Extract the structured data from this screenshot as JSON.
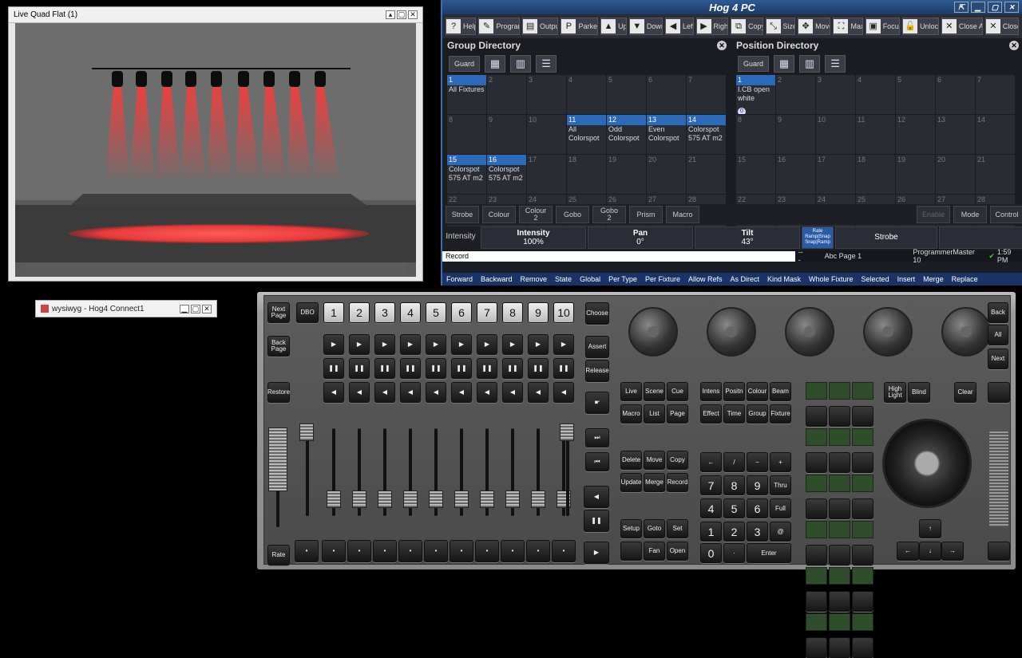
{
  "wysiwyg_window": {
    "title": "Live Quad Flat (1)",
    "minimize": "▴",
    "restore": "▢",
    "close": "✕"
  },
  "taskbar_item": {
    "label": "wysiwyg - Hog4 Connect1"
  },
  "hog": {
    "title": "Hog 4 PC",
    "window_controls": [
      "⇱",
      "▁",
      "▢",
      "✕"
    ],
    "toolbar": [
      {
        "label": "Help",
        "icon": "?"
      },
      {
        "label": "Program",
        "icon": "✎"
      },
      {
        "label": "Output",
        "icon": "▤"
      },
      {
        "label": "Parked",
        "icon": "P"
      },
      {
        "label": "Up",
        "icon": "▲"
      },
      {
        "label": "Down",
        "icon": "▼"
      },
      {
        "label": "Left",
        "icon": "◀"
      },
      {
        "label": "Right",
        "icon": "▶"
      },
      {
        "label": "Copy",
        "icon": "⧉"
      },
      {
        "label": "Size",
        "icon": "⤡"
      },
      {
        "label": "Move",
        "icon": "✥"
      },
      {
        "label": "Max",
        "icon": "⛶"
      },
      {
        "label": "Focus",
        "icon": "▣"
      },
      {
        "label": "Unlock",
        "icon": "🔓"
      },
      {
        "label": "Close All",
        "icon": "✕"
      },
      {
        "label": "Close",
        "icon": "✕"
      }
    ],
    "group_directory": {
      "title": "Group Directory",
      "guard": "Guard",
      "cells": [
        {
          "n": "1",
          "l": "All Fixtures",
          "on": true
        },
        {
          "n": "2"
        },
        {
          "n": "3"
        },
        {
          "n": "4"
        },
        {
          "n": "5"
        },
        {
          "n": "6"
        },
        {
          "n": "7"
        },
        {
          "n": "8"
        },
        {
          "n": "9"
        },
        {
          "n": "10"
        },
        {
          "n": "11",
          "l": "All Colorspot",
          "on": true
        },
        {
          "n": "12",
          "l": "Odd Colorspot",
          "on": true
        },
        {
          "n": "13",
          "l": "Even Colorspot",
          "on": true
        },
        {
          "n": "14",
          "l": "Colorspot 575 AT m2",
          "on": true
        },
        {
          "n": "15",
          "l": "Colorspot 575 AT m2",
          "on": true
        },
        {
          "n": "16",
          "l": "Colorspot 575 AT m2",
          "on": true
        },
        {
          "n": "17"
        },
        {
          "n": "18"
        },
        {
          "n": "19"
        },
        {
          "n": "20"
        },
        {
          "n": "21"
        },
        {
          "n": "22"
        },
        {
          "n": "23"
        },
        {
          "n": "24"
        },
        {
          "n": "25"
        },
        {
          "n": "26"
        },
        {
          "n": "27"
        },
        {
          "n": "28"
        }
      ]
    },
    "position_directory": {
      "title": "Position Directory",
      "guard": "Guard",
      "cells": [
        {
          "n": "1",
          "l": "I.CB open white",
          "on": true,
          "badge": "0"
        },
        {
          "n": "2"
        },
        {
          "n": "3"
        },
        {
          "n": "4"
        },
        {
          "n": "5"
        },
        {
          "n": "6"
        },
        {
          "n": "7"
        },
        {
          "n": "8"
        },
        {
          "n": "9"
        },
        {
          "n": "10"
        },
        {
          "n": "11"
        },
        {
          "n": "12"
        },
        {
          "n": "13"
        },
        {
          "n": "14"
        },
        {
          "n": "15"
        },
        {
          "n": "16"
        },
        {
          "n": "17"
        },
        {
          "n": "18"
        },
        {
          "n": "19"
        },
        {
          "n": "20"
        },
        {
          "n": "21"
        },
        {
          "n": "22"
        },
        {
          "n": "23"
        },
        {
          "n": "24"
        },
        {
          "n": "25"
        },
        {
          "n": "26"
        },
        {
          "n": "27"
        },
        {
          "n": "28"
        }
      ]
    },
    "kind_keys": [
      "Strobe",
      "Colour",
      "Colour 2",
      "Gobo",
      "Gobo 2",
      "Prism",
      "Macro"
    ],
    "right_keys": [
      "Enable",
      "Mode",
      "Control"
    ],
    "params": {
      "label": "Intensity",
      "items": [
        {
          "name": "Intensity",
          "value": "100%"
        },
        {
          "name": "Pan",
          "value": "0°"
        },
        {
          "name": "Tilt",
          "value": "43°"
        }
      ],
      "strobe_mini": "Rate Ramp|Snap Snap|Ramp",
      "strobe": "Strobe"
    },
    "command_line": "Record",
    "status": {
      "dash": "---",
      "page": "Abc Page 1",
      "master": "ProgrammerMaster 10",
      "time": "1:59 PM"
    },
    "softkeys": [
      "Forward",
      "Backward",
      "Remove",
      "State",
      "Global",
      "Per Type",
      "Per Fixture",
      "Allow Refs",
      "As Direct",
      "Kind Mask",
      "Whole Fixture",
      "Selected",
      "Insert",
      "Merge",
      "Replace"
    ]
  },
  "console": {
    "left_keys": [
      "Next Page",
      "Back Page",
      "Restore",
      "Rate"
    ],
    "dbo": "DBO",
    "masters": [
      "1",
      "2",
      "3",
      "4",
      "5",
      "6",
      "7",
      "8",
      "9",
      "10"
    ],
    "right_master_keys": [
      "Choose",
      "Assert",
      "Release"
    ],
    "encoder_count": 5,
    "nav_keys": [
      "Back",
      "All",
      "Next"
    ],
    "function_keys": [
      [
        "Live",
        "Scene",
        "Cue"
      ],
      [
        "Macro",
        "List",
        "Page"
      ]
    ],
    "kind_keys": [
      [
        "Intens",
        "Positn",
        "Colour",
        "Beam"
      ],
      [
        "Effect",
        "Time",
        "Group",
        "Fixture"
      ]
    ],
    "edit_keys": [
      [
        "Delete",
        "Move",
        "Copy"
      ],
      [
        "Update",
        "Merge",
        "Record"
      ]
    ],
    "setup_keys": [
      [
        "Setup",
        "Goto",
        "Set"
      ],
      [
        "",
        "Fan",
        "Open"
      ]
    ],
    "keypad": [
      [
        "←",
        "/",
        "−",
        "+"
      ],
      [
        "7",
        "8",
        "9",
        "Thru"
      ],
      [
        "4",
        "5",
        "6",
        "Full"
      ],
      [
        "1",
        "2",
        "3",
        "@"
      ]
    ],
    "keypad_bottom": [
      "0",
      "·",
      "Enter"
    ],
    "highlight": "High Light",
    "blind": "Blind",
    "clear": "Clear",
    "arrows": [
      "↑",
      "←",
      "↓",
      "→"
    ]
  }
}
